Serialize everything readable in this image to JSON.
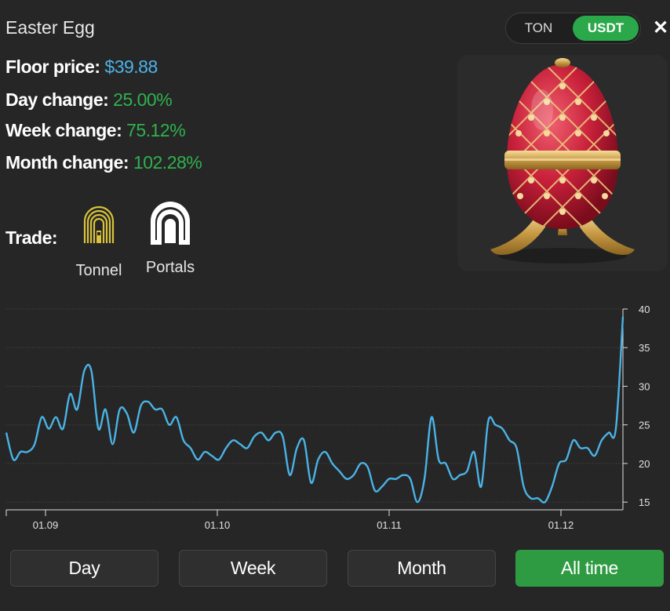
{
  "header": {
    "title": "Easter Egg",
    "currency_options": [
      "TON",
      "USDT"
    ],
    "selected_currency": "USDT",
    "close_icon": "close-icon"
  },
  "stats": {
    "floor_label": "Floor price:",
    "floor_value": "$39.88",
    "day_label": "Day change:",
    "day_value": "25.00%",
    "week_label": "Week change:",
    "week_value": "75.12%",
    "month_label": "Month change:",
    "month_value": "102.28%"
  },
  "trade": {
    "label": "Trade:",
    "markets": [
      {
        "name": "Tonnel",
        "icon": "tonnel-logo-icon"
      },
      {
        "name": "Portals",
        "icon": "portals-logo-icon"
      }
    ]
  },
  "item_image": "easter-egg-image",
  "colors": {
    "accent_green": "#2aa84a",
    "value_blue": "#4db3e8",
    "value_green": "#2fb24f",
    "line": "#4ab3e6"
  },
  "range_buttons": [
    "Day",
    "Week",
    "Month",
    "All time"
  ],
  "selected_range": "All time",
  "chart_data": {
    "type": "line",
    "x_ticks": [
      "01.09",
      "01.10",
      "01.11",
      "01.12"
    ],
    "y_ticks": [
      15,
      20,
      25,
      30,
      35,
      40
    ],
    "ylim": [
      14,
      40
    ],
    "grid": true,
    "y_axis_position": "right",
    "series": [
      {
        "values": [
          24.0,
          20.5,
          21.5,
          21.5,
          22.5,
          26.0,
          24.5,
          26.0,
          24.5,
          29.0,
          27.0,
          32.0,
          32.0,
          24.5,
          27.0,
          22.5,
          27.0,
          26.5,
          24.0,
          27.5,
          28.0,
          27.0,
          27.0,
          25.0,
          26.0,
          23.0,
          22.0,
          20.5,
          21.5,
          21.0,
          20.5,
          22.0,
          23.0,
          22.5,
          22.0,
          23.5,
          24.0,
          23.0,
          24.0,
          23.5,
          18.5,
          22.0,
          23.0,
          17.5,
          20.5,
          21.5,
          20.0,
          19.0,
          18.0,
          18.5,
          20.0,
          19.5,
          16.5,
          17.0,
          18.0,
          18.0,
          18.5,
          18.0,
          15.0,
          18.0,
          26.0,
          20.5,
          20.0,
          18.0,
          18.5,
          19.0,
          21.5,
          17.0,
          25.5,
          25.0,
          24.5,
          23.0,
          22.0,
          17.0,
          15.5,
          15.5,
          15.0,
          17.0,
          20.0,
          20.5,
          23.0,
          22.0,
          22.0,
          21.0,
          23.0,
          24.0,
          24.5,
          39.0
        ]
      }
    ]
  }
}
